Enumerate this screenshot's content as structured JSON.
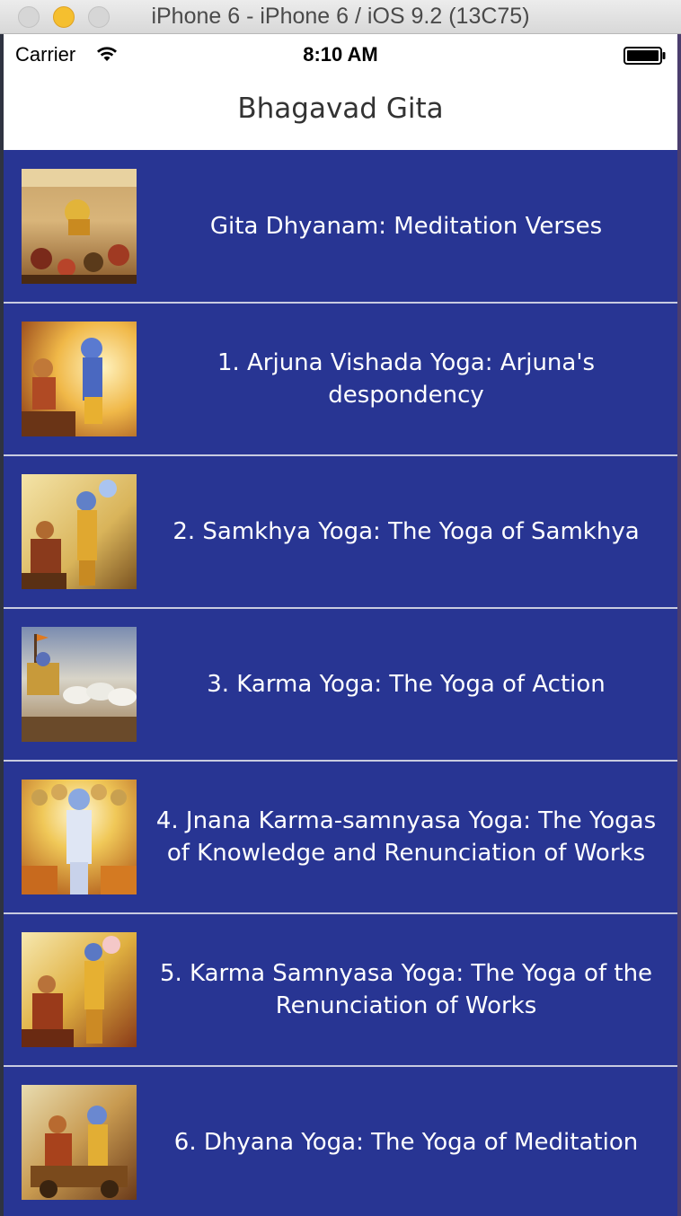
{
  "simulator": {
    "window_title": "iPhone 6 - iPhone 6 / iOS 9.2 (13C75)"
  },
  "status_bar": {
    "carrier": "Carrier",
    "time": "8:10 AM",
    "wifi_icon": "wifi-icon",
    "battery_icon": "battery-icon"
  },
  "nav": {
    "title": "Bhagavad Gita"
  },
  "colors": {
    "list_background": "#283593",
    "separator": "#c8cbe0",
    "text": "#ffffff"
  },
  "chapters": [
    {
      "title": "Gita Dhyanam: Meditation Verses",
      "image": "battlefield-painting"
    },
    {
      "title": "1. Arjuna Vishada Yoga: Arjuna's despondency",
      "image": "krishna-arjuna-painting"
    },
    {
      "title": "2. Samkhya Yoga: The Yoga of Samkhya",
      "image": "krishna-teaching-painting"
    },
    {
      "title": "3. Karma Yoga: The Yoga of Action",
      "image": "chariot-horses-painting"
    },
    {
      "title": "4. Jnana Karma-samnyasa Yoga: The Yogas of Knowledge and Renunciation of Works",
      "image": "vishvarupa-painting"
    },
    {
      "title": "5. Karma Samnyasa Yoga: The Yoga of the Renunciation of Works",
      "image": "krishna-blessing-painting"
    },
    {
      "title": "6. Dhyana Yoga: The Yoga of Meditation",
      "image": "chariot-warrior-painting"
    }
  ]
}
